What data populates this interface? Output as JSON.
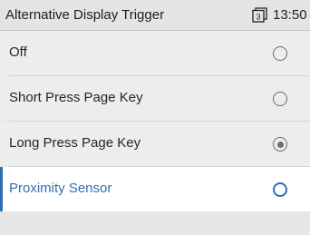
{
  "header": {
    "title": "Alternative Display Trigger",
    "page_badge": "3",
    "time": "13:50"
  },
  "options": [
    {
      "label": "Off",
      "checked": false,
      "focused": false
    },
    {
      "label": "Short Press Page Key",
      "checked": false,
      "focused": false
    },
    {
      "label": "Long Press Page Key",
      "checked": true,
      "focused": false
    },
    {
      "label": "Proximity Sensor",
      "checked": false,
      "focused": true
    }
  ],
  "colors": {
    "accent": "#2f6fb0",
    "background": "#e6e6e6",
    "row_bg": "#ededed",
    "focused_row_bg": "#ffffff"
  },
  "icons": {
    "status_page": "page-icon",
    "option_selector": "radio-button-icon"
  }
}
